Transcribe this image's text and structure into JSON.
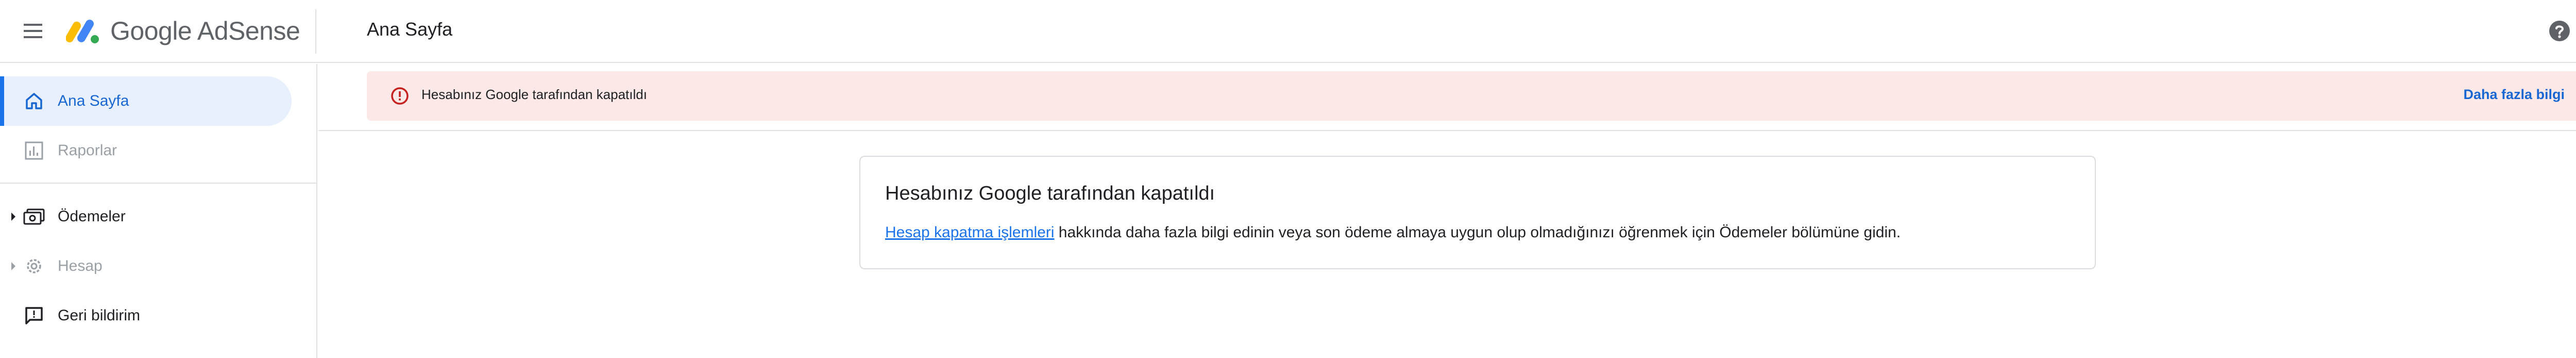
{
  "header": {
    "logo_text": "Google AdSense",
    "page_title": "Ana Sayfa"
  },
  "sidebar": {
    "items": [
      {
        "label": "Ana Sayfa",
        "icon": "home-icon"
      },
      {
        "label": "Raporlar",
        "icon": "bar-chart-icon"
      },
      {
        "label": "Ödemeler",
        "icon": "payments-icon"
      },
      {
        "label": "Hesap",
        "icon": "gear-icon"
      },
      {
        "label": "Geri bildirim",
        "icon": "feedback-icon"
      }
    ]
  },
  "alert": {
    "message": "Hesabınız Google tarafından kapatıldı",
    "link_text": "Daha fazla bilgi"
  },
  "card": {
    "title": "Hesabınız Google tarafından kapatıldı",
    "link_text": "Hesap kapatma işlemleri",
    "body_text": " hakkında daha fazla bilgi edinin veya son ödeme almaya uygun olup olmadığınızı öğrenmek için Ödemeler bölümüne gidin."
  },
  "colors": {
    "accent": "#1a73e8",
    "active_bg": "#e8f0fe",
    "alert_bg": "#fce8e6",
    "error": "#c5221f"
  }
}
